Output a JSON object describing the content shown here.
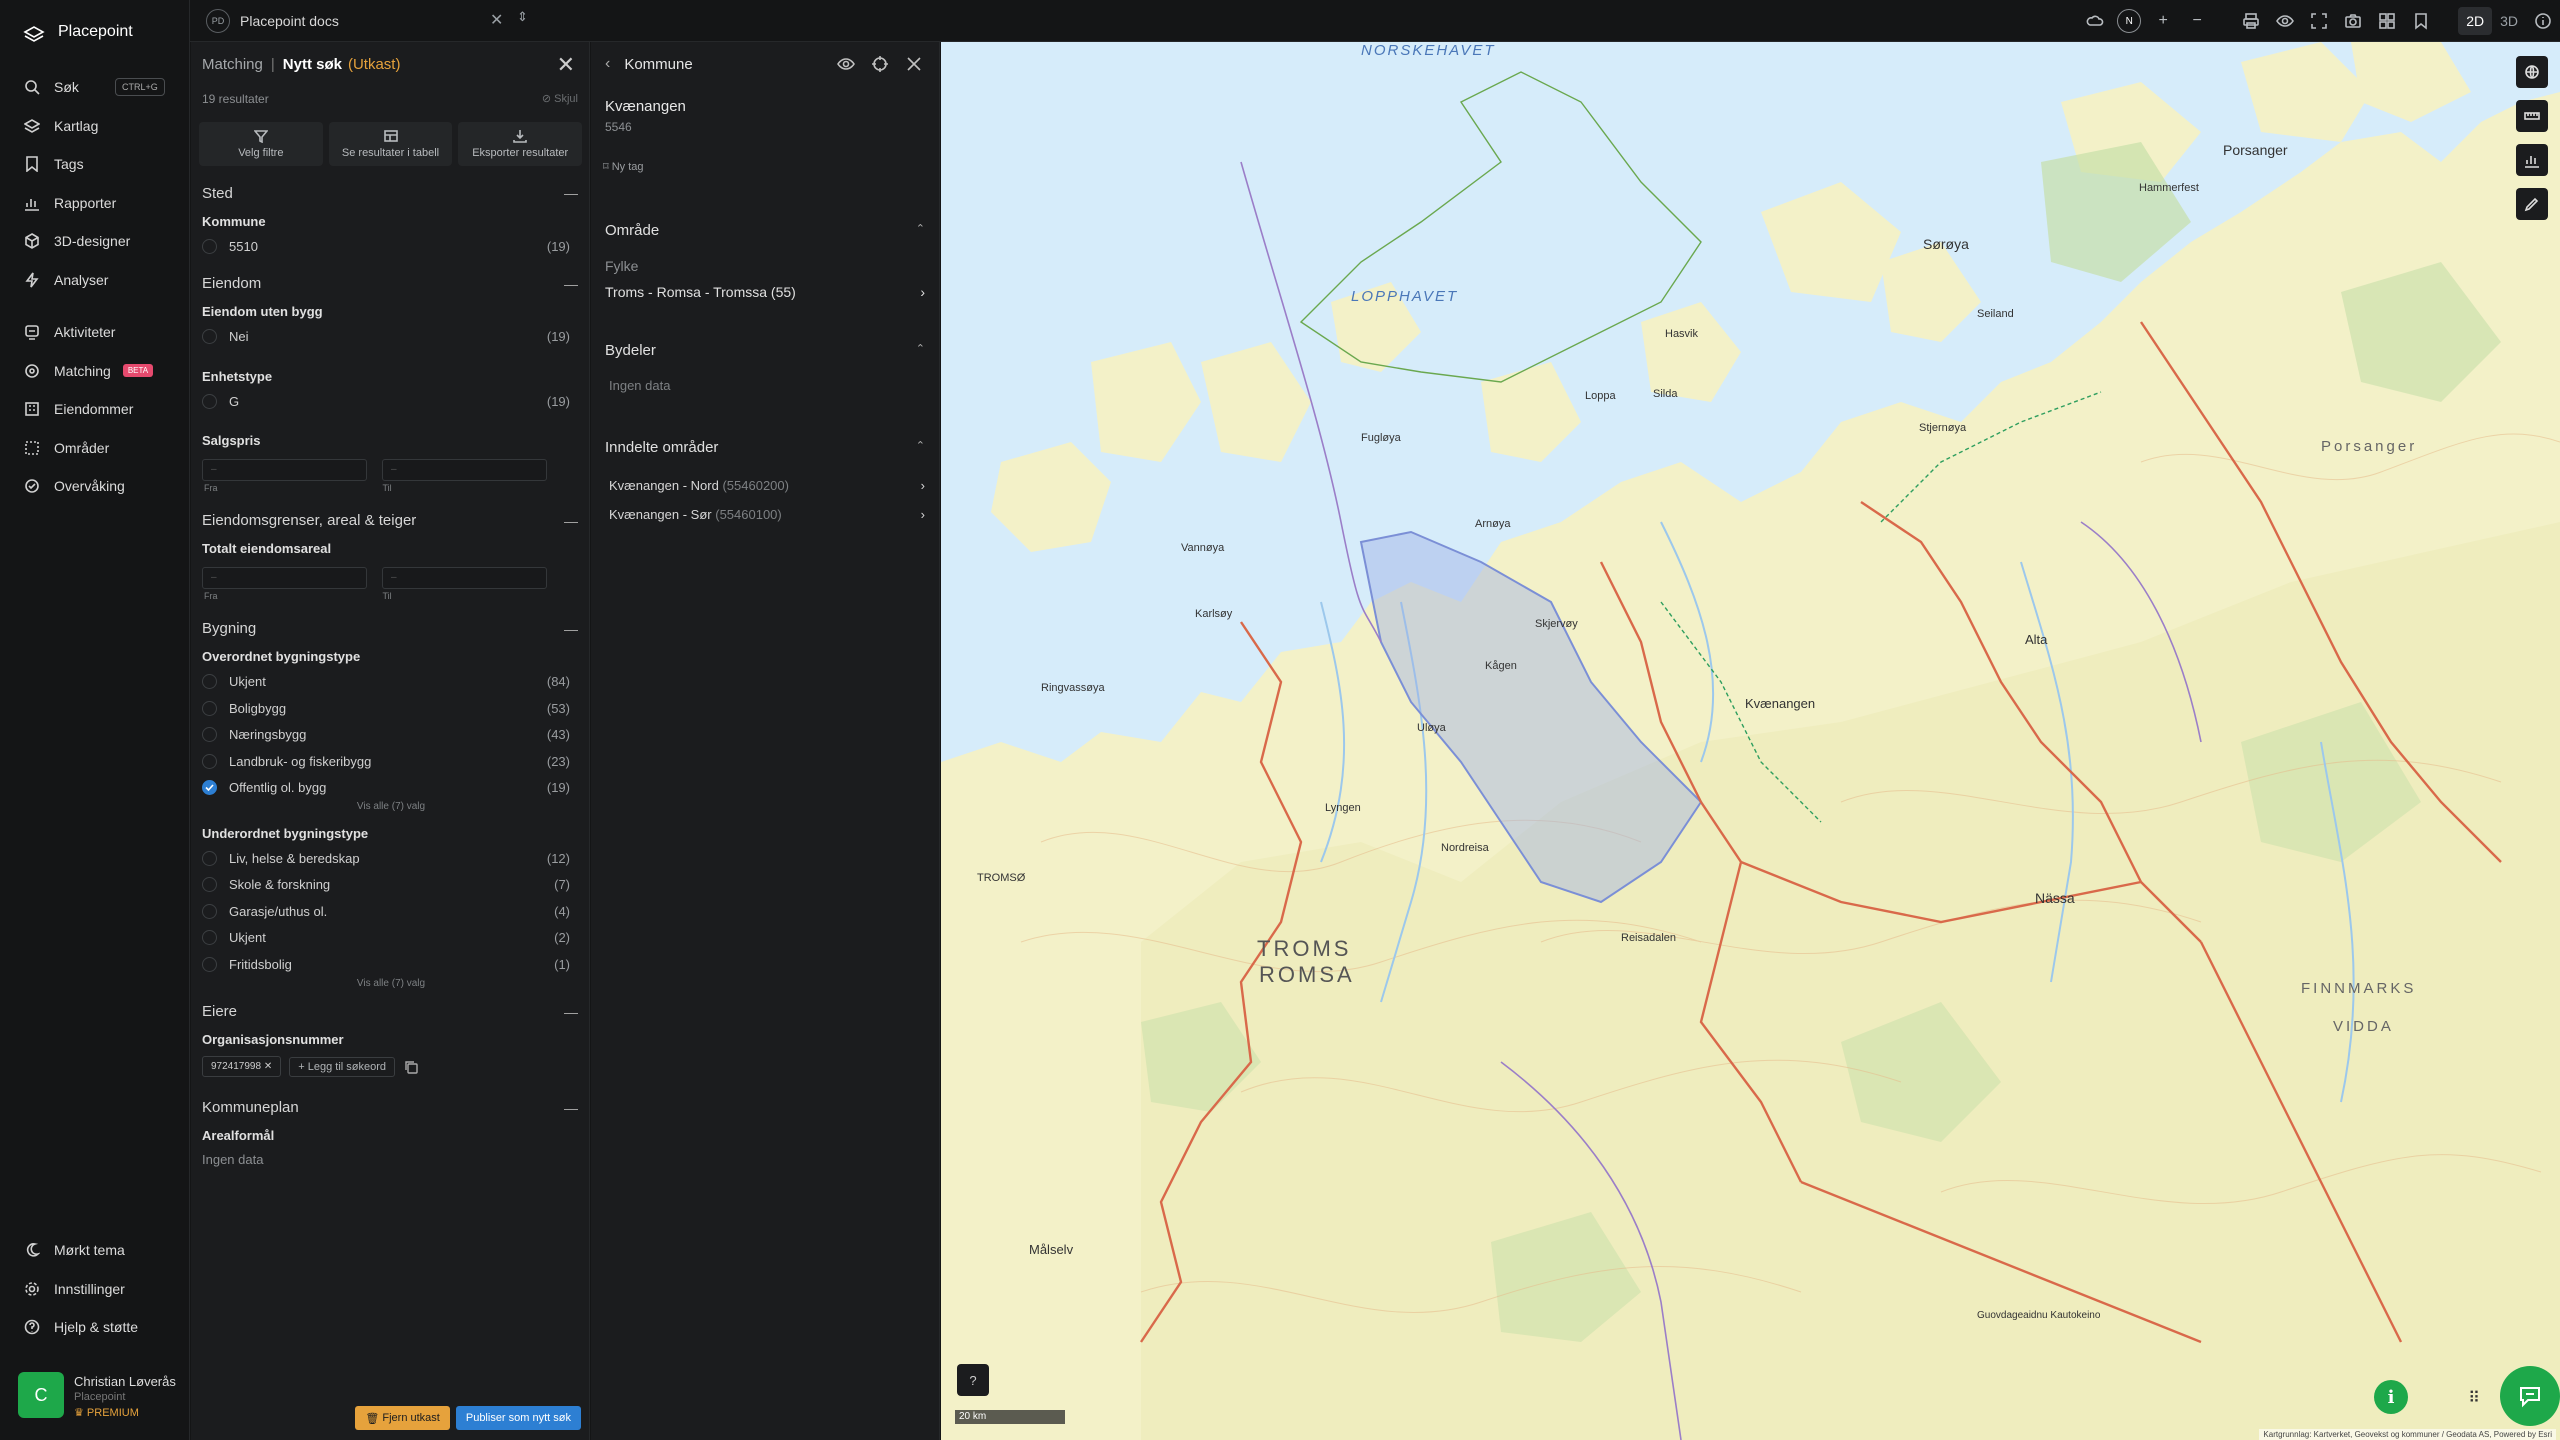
{
  "brand": {
    "name": "Placepoint"
  },
  "topbar": {
    "doc_badge": "PD",
    "doc_title": "Placepoint docs",
    "mode_2d": "2D",
    "mode_3d": "3D",
    "compass": "N"
  },
  "nav": {
    "search": {
      "label": "Søk",
      "shortcut": "CTRL+G"
    },
    "items": [
      {
        "label": "Kartlag",
        "icon": "layers-icon"
      },
      {
        "label": "Tags",
        "icon": "bookmark-icon"
      },
      {
        "label": "Rapporter",
        "icon": "chart-icon"
      },
      {
        "label": "3D-designer",
        "icon": "cube-icon"
      },
      {
        "label": "Analyser",
        "icon": "bolt-icon"
      }
    ],
    "items2": [
      {
        "label": "Aktiviteter",
        "icon": "activity-icon"
      },
      {
        "label": "Matching",
        "icon": "target-icon",
        "badge": "BETA"
      },
      {
        "label": "Eiendommer",
        "icon": "building-icon"
      },
      {
        "label": "Områder",
        "icon": "area-icon"
      },
      {
        "label": "Overvåking",
        "icon": "monitor-icon"
      }
    ],
    "bottom": [
      {
        "label": "Mørkt tema",
        "icon": "moon-icon"
      },
      {
        "label": "Innstillinger",
        "icon": "gear-icon"
      },
      {
        "label": "Hjelp & støtte",
        "icon": "help-icon"
      }
    ]
  },
  "user": {
    "initial": "C",
    "name": "Christian Løverås",
    "org": "Placepoint",
    "plan": "PREMIUM"
  },
  "filter": {
    "crumb": "Matching",
    "title": "Nytt søk",
    "status": "(Utkast)",
    "result_count": "19 resultater",
    "hide": "Skjul",
    "actions": {
      "filters": "Velg filtre",
      "table": "Se resultater i tabell",
      "export": "Eksporter resultater"
    },
    "sted": {
      "title": "Sted",
      "kommune_label": "Kommune",
      "kommune": {
        "label": "5510",
        "count": "(19)"
      }
    },
    "eiendom": {
      "title": "Eiendom",
      "uten_bygg_label": "Eiendom uten bygg",
      "uten_bygg": {
        "label": "Nei",
        "count": "(19)"
      },
      "enhetstype_label": "Enhetstype",
      "enhetstype": {
        "label": "G",
        "count": "(19)"
      },
      "salgspris_label": "Salgspris",
      "from_placeholder": "–",
      "to_placeholder": "–",
      "from_label": "Fra",
      "to_label": "Til"
    },
    "grenser": {
      "title": "Eiendomsgrenser, areal & teiger",
      "areal_label": "Totalt eiendomsareal",
      "from_placeholder": "–",
      "to_placeholder": "–",
      "from_label": "Fra",
      "to_label": "Til"
    },
    "bygning": {
      "title": "Bygning",
      "overordnet_label": "Overordnet bygningstype",
      "overordnet": [
        {
          "label": "Ukjent",
          "count": "(84)",
          "checked": false
        },
        {
          "label": "Boligbygg",
          "count": "(53)",
          "checked": false
        },
        {
          "label": "Næringsbygg",
          "count": "(43)",
          "checked": false
        },
        {
          "label": "Landbruk- og fiskeribygg",
          "count": "(23)",
          "checked": false
        },
        {
          "label": "Offentlig ol. bygg",
          "count": "(19)",
          "checked": true
        }
      ],
      "overordnet_showall": "Vis alle (7) valg",
      "underordnet_label": "Underordnet bygningstype",
      "underordnet": [
        {
          "label": "Liv, helse & beredskap",
          "count": "(12)"
        },
        {
          "label": "Skole & forskning",
          "count": "(7)"
        },
        {
          "label": "Garasje/uthus ol.",
          "count": "(4)"
        },
        {
          "label": "Ukjent",
          "count": "(2)"
        },
        {
          "label": "Fritidsbolig",
          "count": "(1)"
        }
      ],
      "underordnet_showall": "Vis alle (7) valg"
    },
    "eiere": {
      "title": "Eiere",
      "org_label": "Organisasjonsnummer",
      "chip": "972417998",
      "add_keyword": "Legg til søkeord"
    },
    "kommuneplan": {
      "title": "Kommuneplan",
      "areal_label": "Arealformål",
      "empty": "Ingen data"
    },
    "remove_draft": "Fjern utkast",
    "publish": "Publiser som nytt søk"
  },
  "detail": {
    "title": "Kommune",
    "name": "Kvænangen",
    "number": "5546",
    "new_tag": "Ny tag",
    "omrade": {
      "title": "Område",
      "fylke_label": "Fylke",
      "fylke_value": "Troms - Romsa - Tromssa (55)"
    },
    "bydeler": {
      "title": "Bydeler",
      "empty": "Ingen data"
    },
    "inndelte": {
      "title": "Inndelte områder",
      "items": [
        {
          "name": "Kvænangen - Nord",
          "code": "(55460200)"
        },
        {
          "name": "Kvænangen - Sør",
          "code": "(55460100)"
        }
      ]
    }
  },
  "map": {
    "labels": {
      "norskehavet": "NORSKEHAVET",
      "lopphavet": "LOPPHAVET",
      "troms": "TROMS",
      "romsa": "ROMSA",
      "finnmarks": "FINNMARKS",
      "vidda": "VIDDA",
      "porsanger": "Porsanger",
      "soroya": "Sørøya",
      "kvanangen": "Kvænangen",
      "alta": "Alta",
      "nassa": "Nässa",
      "tromso": "TROMSØ",
      "malselv": "Målselv",
      "fugloya": "Fugløya",
      "arnoya": "Arnøya",
      "skjervoy": "Skjervøy",
      "hammerfest": "Hammerfest",
      "loppa": "Loppa",
      "silda": "Silda",
      "lyngen": "Lyngen",
      "uloya": "Uløya",
      "kageen": "Kågen",
      "hasvik": "Hasvik",
      "seiland": "Seiland",
      "stjernoya": "Stjernøya",
      "reisadalen": "Reisadalen",
      "kautokeino": "Guovdageaidnu Kautokeino",
      "ringvassoya": "Ringvassøya",
      "vanna": "Vannøya",
      "karlsoy": "Karlsøy",
      "nordreisa": "Nordreisa"
    },
    "scale": "20 km",
    "attribution": "Kartgrunnlag: Kartverket, Geovekst og kommuner / Geodata AS, Powered by Esri"
  },
  "colors": {
    "accent": "#2d7fd3",
    "brand_green": "#1ea84a",
    "draft": "#e6a23c",
    "beta": "#e64a6e"
  }
}
